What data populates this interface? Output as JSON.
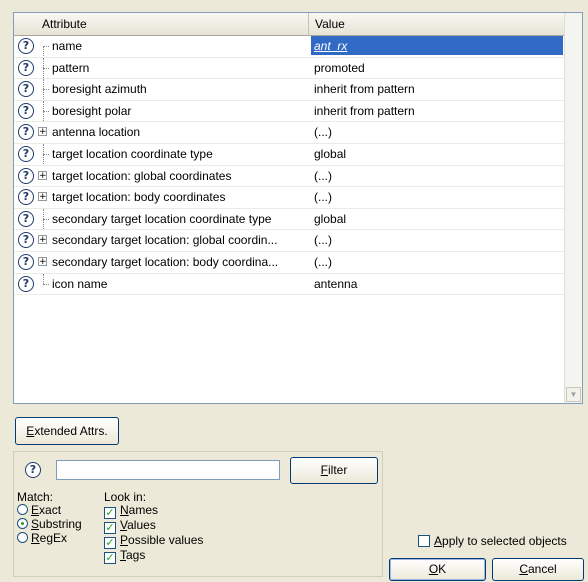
{
  "grid": {
    "col_attribute": "Attribute",
    "col_value": "Value",
    "rows": [
      {
        "label": "name",
        "value": "ant_rx",
        "expandable": false,
        "selected": true
      },
      {
        "label": "pattern",
        "value": "promoted",
        "expandable": false,
        "selected": false
      },
      {
        "label": "boresight azimuth",
        "value": "inherit from pattern",
        "expandable": false,
        "selected": false
      },
      {
        "label": "boresight polar",
        "value": "inherit from pattern",
        "expandable": false,
        "selected": false
      },
      {
        "label": "antenna location",
        "value": "(...)",
        "expandable": true,
        "selected": false
      },
      {
        "label": "target location coordinate type",
        "value": "global",
        "expandable": false,
        "selected": false
      },
      {
        "label": "target location: global coordinates",
        "value": "(...)",
        "expandable": true,
        "selected": false
      },
      {
        "label": "target location: body coordinates",
        "value": "(...)",
        "expandable": true,
        "selected": false
      },
      {
        "label": "secondary target location coordinate type",
        "value": "global",
        "expandable": false,
        "selected": false
      },
      {
        "label": "secondary target location: global coordin...",
        "value": "(...)",
        "expandable": true,
        "selected": false
      },
      {
        "label": "secondary target location: body coordina...",
        "value": "(...)",
        "expandable": true,
        "selected": false
      },
      {
        "label": "icon name",
        "value": "antenna",
        "expandable": false,
        "selected": false
      }
    ],
    "row_icon": "help-question-icon",
    "scroll_down_glyph": "▼"
  },
  "extended_attrs_button": {
    "prefix": "E",
    "rest": "xtended Attrs."
  },
  "filter": {
    "input_value": "",
    "button_prefix": "F",
    "button_rest": "ilter",
    "match_label": "Match:",
    "match_options": [
      {
        "prefix": "E",
        "rest": "xact",
        "selected": false
      },
      {
        "prefix": "S",
        "rest": "ubstring",
        "selected": true
      },
      {
        "prefix": "R",
        "rest": "egEx",
        "selected": false
      }
    ],
    "lookin_label": "Look in:",
    "lookin_options": [
      {
        "prefix": "N",
        "rest": "ames",
        "checked": true
      },
      {
        "prefix": "V",
        "rest": "alues",
        "checked": true
      },
      {
        "prefix": "P",
        "rest": "ossible values",
        "checked": true
      },
      {
        "prefix": "T",
        "rest": "ags",
        "checked": true
      }
    ]
  },
  "apply": {
    "prefix": "A",
    "rest": "pply to selected objects",
    "checked": false
  },
  "ok_button": {
    "prefix": "O",
    "rest": "K"
  },
  "cancel_button": {
    "prefix": "C",
    "rest": "ancel"
  },
  "glyphs": {
    "question": "?",
    "check": "✓",
    "plus": "+"
  }
}
